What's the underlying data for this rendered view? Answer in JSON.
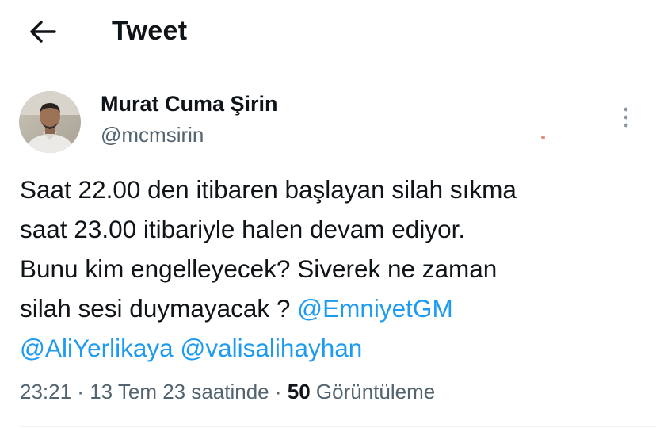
{
  "header": {
    "back_icon": "arrow-left-icon",
    "title": "Tweet"
  },
  "author": {
    "name": "Murat Cuma Şirin",
    "handle": "@mcmsirin"
  },
  "tweet": {
    "line1": "Saat 22.00 den itibaren başlayan silah sıkma",
    "line2": "saat 23.00 itibariyle halen devam ediyor.",
    "line3": "Bunu kim engelleyecek? Siverek ne zaman",
    "line4_text": "silah sesi duymayacak ? ",
    "mention1": "@EmniyetGM",
    "mention2": "@AliYerlikaya",
    "mention3": "@valisalihayhan"
  },
  "meta": {
    "time": "23:21",
    "separator": " · ",
    "date": "13 Tem 23 saatinde",
    "views_count": "50",
    "views_label": " Görüntüleme"
  },
  "colors": {
    "text": "#0f1419",
    "secondary": "#536471",
    "link": "#1d9bf0",
    "divider": "#eff3f4"
  }
}
